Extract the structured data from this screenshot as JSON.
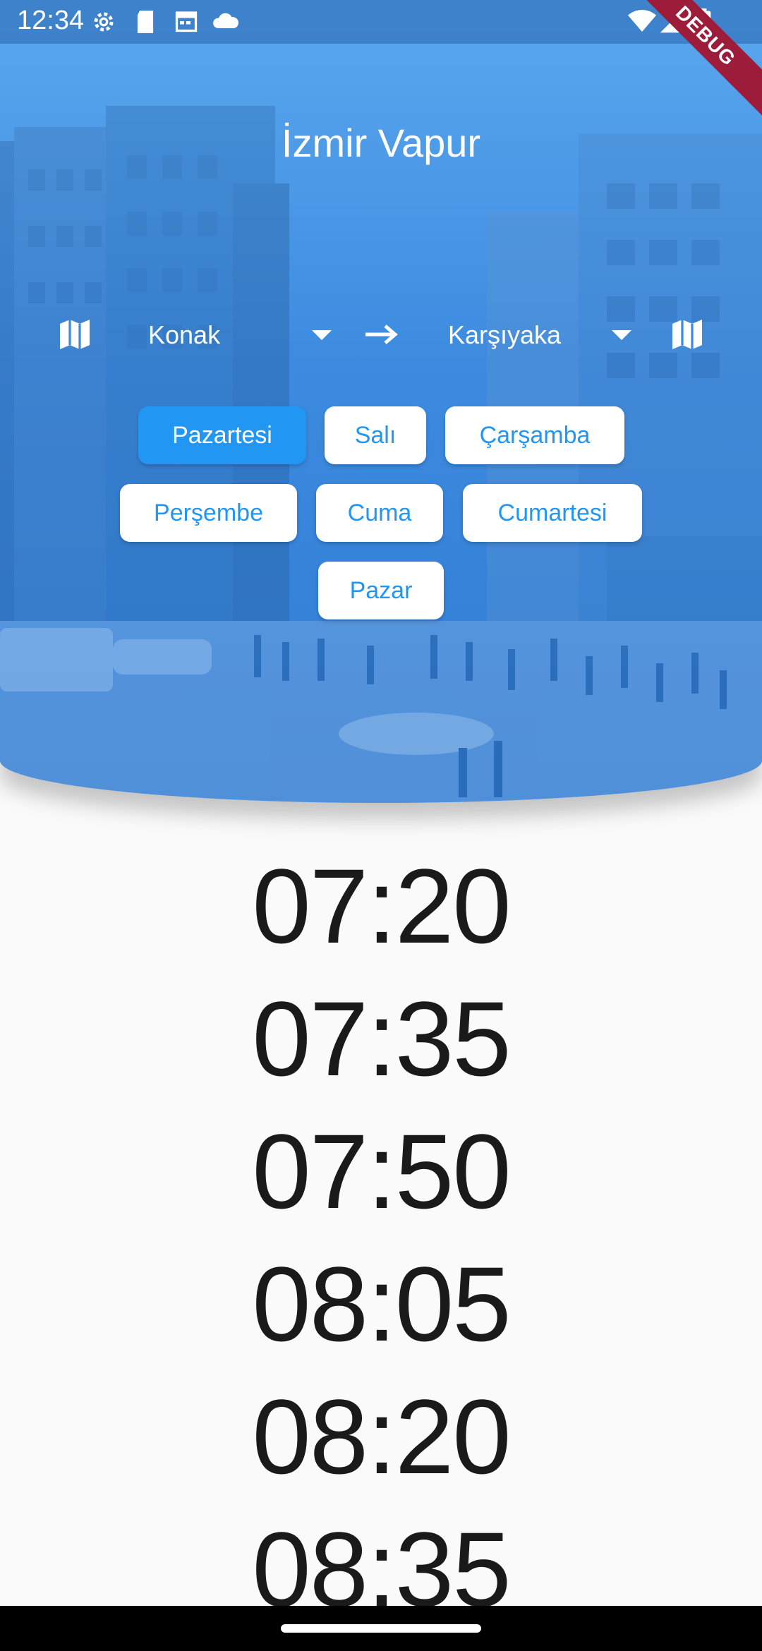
{
  "status_bar": {
    "time": "12:34",
    "left_icons": [
      "gear-icon",
      "sd-card-icon",
      "calendar-icon",
      "cloud-icon"
    ],
    "right_icons": [
      "wifi-icon",
      "signal-icon",
      "battery-icon"
    ]
  },
  "debug_banner": "DEBUG",
  "header": {
    "title": "İzmir Vapur",
    "background": "izmir-street-photo"
  },
  "route": {
    "from": "Konak",
    "to": "Karşıyaka",
    "left_icon": "map-icon",
    "right_icon": "map-icon",
    "separator_icon": "arrow-right-icon"
  },
  "days": [
    {
      "label": "Pazartesi",
      "selected": true
    },
    {
      "label": "Salı",
      "selected": false
    },
    {
      "label": "Çarşamba",
      "selected": false
    },
    {
      "label": "Perşembe",
      "selected": false
    },
    {
      "label": "Cuma",
      "selected": false
    },
    {
      "label": "Cumartesi",
      "selected": false
    },
    {
      "label": "Pazar",
      "selected": false
    }
  ],
  "times": [
    "07:20",
    "07:35",
    "07:50",
    "08:05",
    "08:20",
    "08:35"
  ],
  "colors": {
    "accent": "#2196f3",
    "header_overlay": "#3d8be0",
    "debug_ribbon": "#9c1c3a"
  }
}
